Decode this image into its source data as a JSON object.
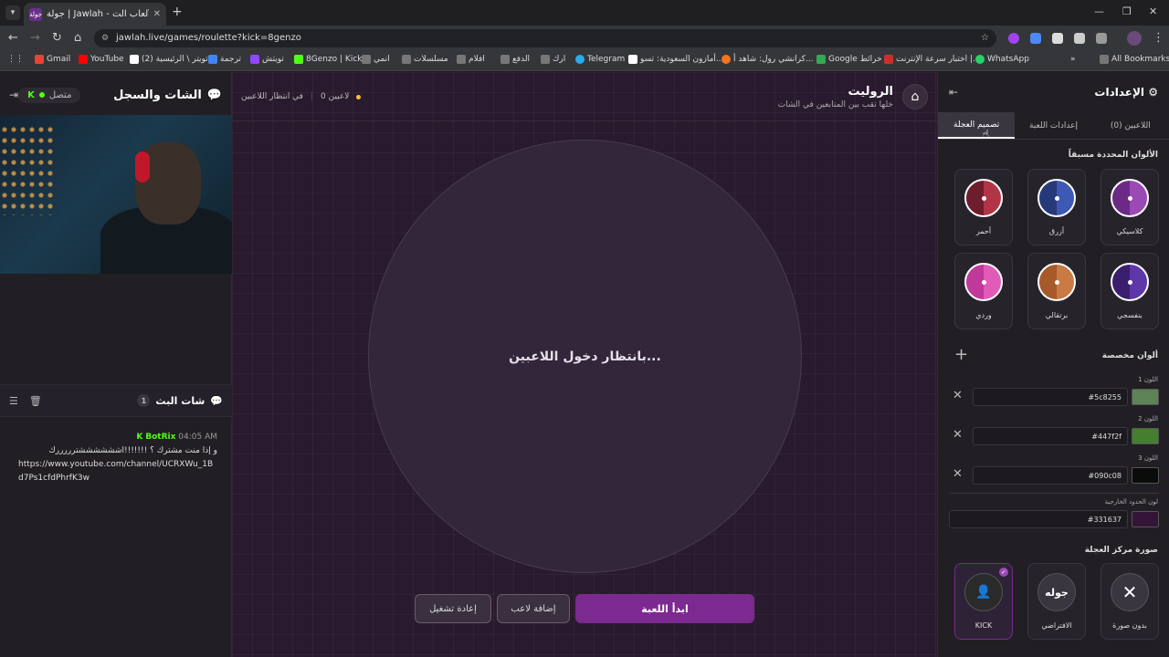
{
  "browser": {
    "tab_title": "جولة | Jawlah - منصة الألعاب الت...",
    "tab_favicon": "جولة",
    "url": "jawlah.live/games/roulette?kick=8genzo",
    "bookmarks": [
      {
        "label": "Gmail",
        "color": "#ea4335"
      },
      {
        "label": "YouTube",
        "color": "#ff0000"
      },
      {
        "label": "(2) تويتر \\ الرئيسية",
        "color": "#ffffff"
      },
      {
        "label": "ترجمة",
        "color": "#4285f4"
      },
      {
        "label": "تويتش",
        "color": "#9146ff"
      },
      {
        "label": "8Genzo | Kick",
        "color": "#53fc18"
      },
      {
        "label": "انمي",
        "color": "#888888"
      },
      {
        "label": "مسلسلات",
        "color": "#888888"
      },
      {
        "label": "افلام",
        "color": "#888888"
      },
      {
        "label": "الدفع",
        "color": "#888888"
      },
      {
        "label": "ارك",
        "color": "#888888"
      },
      {
        "label": "Telegram",
        "color": "#2aabee"
      },
      {
        "label": "أمازون السعودية: تسو...",
        "color": "#ffffff"
      },
      {
        "label": "كرانشي رول: شاهد أ...",
        "color": "#f47521"
      },
      {
        "label": "Google خرائط",
        "color": "#34a853"
      },
      {
        "label": "اختبار سرعة الإنترنت |...",
        "color": "#c9302c"
      },
      {
        "label": "WhatsApp",
        "color": "#25d366"
      }
    ],
    "all_bookmarks": "All Bookmarks"
  },
  "chat": {
    "title": "الشات والسجل",
    "status": "متصل",
    "stream_title": "شات البث",
    "stream_count": "1",
    "message": {
      "user": "BotRix",
      "time": "04:05 AM",
      "text": "و إذا منت مشترك ؟ !!!!!!!اششششششترررررك",
      "link": "https://www.youtube.com/channel/UCRXWu_1Bd7Ps1cfdPhrfK3w"
    }
  },
  "center": {
    "players": "0 لاعبين",
    "waiting_status": "في انتظار اللاعبين",
    "game_title": "الروليت",
    "game_subtitle": "خلها تقب بين المتابعين في الشات",
    "wheel_text": "بانتظار دخول اللاعبين...",
    "btn_start": "ابدأ اللعبة",
    "btn_add": "إضافة لاعب",
    "btn_restart": "إعادة تشغيل"
  },
  "settings": {
    "title": "الإعدادات",
    "tabs": [
      "اللاعبين (0)",
      "إعدادات اللعبة",
      "تصميم العجلة"
    ],
    "preset_title": "الألوان المحددة مسبقاً",
    "presets": [
      {
        "label": "كلاسيكي",
        "a": "#6b2a86",
        "b": "#9a49b5"
      },
      {
        "label": "أزرق",
        "a": "#263a7a",
        "b": "#3d59b3"
      },
      {
        "label": "أحمر",
        "a": "#6e1d2c",
        "b": "#b03547"
      },
      {
        "label": "بنفسجي",
        "a": "#3a1f6e",
        "b": "#5e37a8"
      },
      {
        "label": "برتقالي",
        "a": "#a65a2a",
        "b": "#c97a45"
      },
      {
        "label": "وردي",
        "a": "#c0389a",
        "b": "#e05bb8"
      }
    ],
    "custom_title": "ألوان مخصصة",
    "colors": [
      {
        "label": "اللون 1",
        "value": "#5c8255",
        "hex": "#5c8255"
      },
      {
        "label": "اللون 2",
        "value": "#447f2f",
        "hex": "#447f2f"
      },
      {
        "label": "اللون 3",
        "value": "#090c08",
        "hex": "#090c08"
      }
    ],
    "border_label": "لون الحدود الخارجية",
    "border_value": "#331637",
    "border_hex": "#331637",
    "center_img_title": "صورة مركز العجلة",
    "images": [
      {
        "label": "بدون صورة"
      },
      {
        "label": "الافتراضي",
        "glyph": "جوله"
      },
      {
        "label": "KICK"
      }
    ]
  }
}
